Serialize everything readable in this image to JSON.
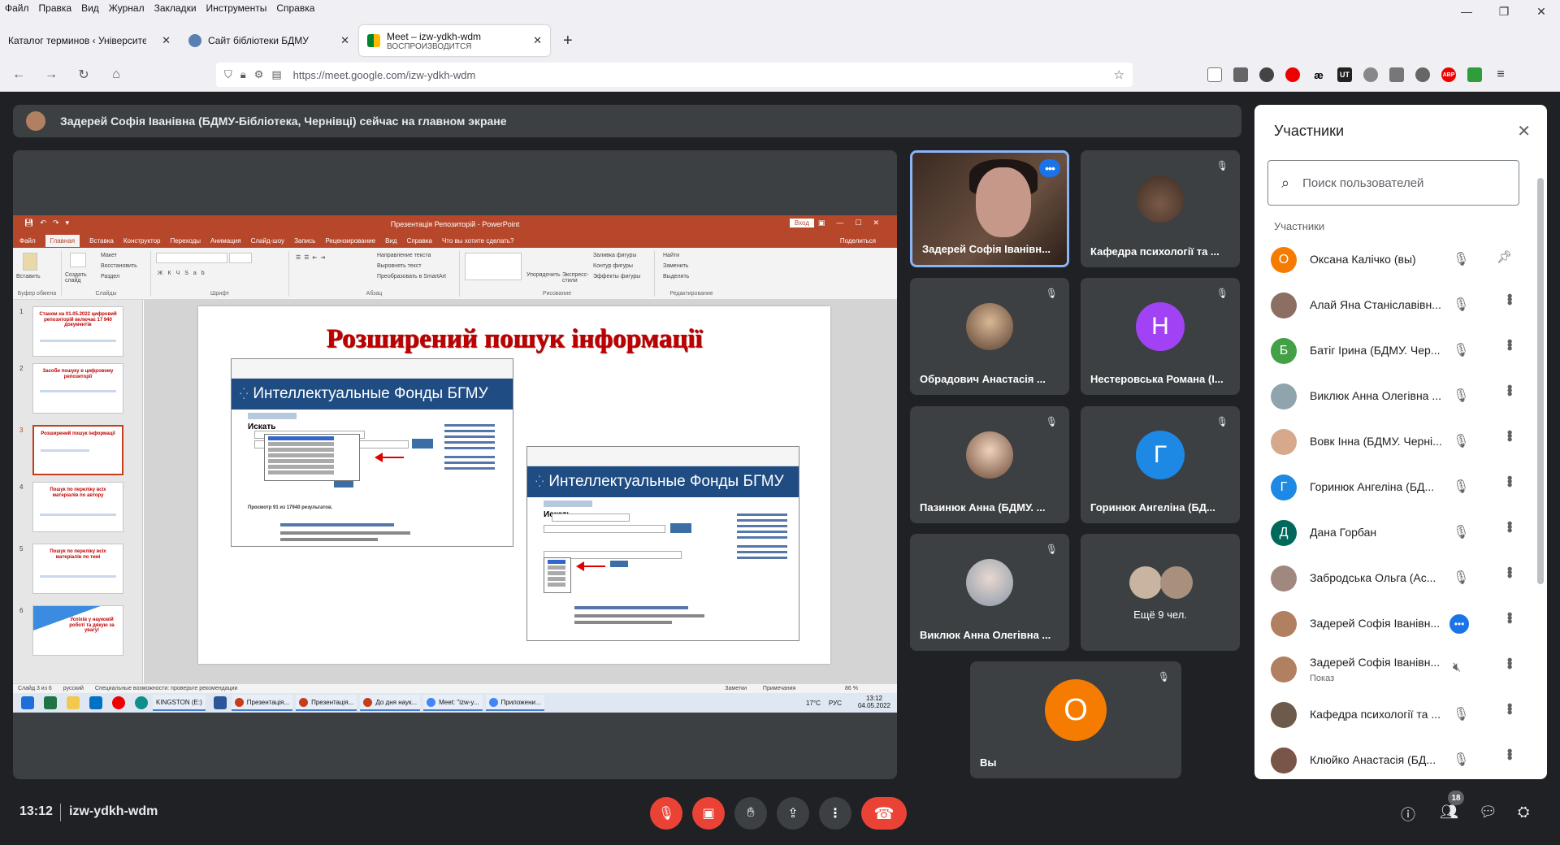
{
  "browser": {
    "menu": [
      "Файл",
      "Правка",
      "Вид",
      "Журнал",
      "Закладки",
      "Инструменты",
      "Справка"
    ],
    "tabs": [
      {
        "title": "Каталог терминов ‹ Університетоз",
        "sub": ""
      },
      {
        "title": "Сайт бібліотеки БДМУ",
        "sub": ""
      },
      {
        "title": "Meet – izw-ydkh-wdm",
        "sub": "ВОСПРОИЗВОДИТСЯ"
      }
    ],
    "url": "https://meet.google.com/izw-ydkh-wdm",
    "ext": {
      "abp": "ABP",
      "ae": "æ",
      "ut": "UT"
    }
  },
  "banner": "Задерей Софія Іванівна (БДМУ-Бібліотека, Чернівці) сейчас на главном экране",
  "presentation": {
    "window_title": "Презентація Репозиторій - PowerPoint",
    "login": "Вход",
    "ribbon_tabs": [
      "Файл",
      "Главная",
      "Вставка",
      "Конструктор",
      "Переходы",
      "Анимация",
      "Слайд-шоу",
      "Запись",
      "Рецензирование",
      "Вид",
      "Справка",
      "Что вы хотите сделать?"
    ],
    "share": "Поделиться",
    "ribbon": {
      "paste": "Вставить",
      "new_slide": "Создать слайд",
      "layout": "Макет",
      "reset": "Восстановить",
      "section": "Раздел",
      "g_clip": "Буфер обмена",
      "g_slides": "Слайды",
      "g_font": "Шрифт",
      "g_para": "Абзац",
      "g_draw": "Рисование",
      "g_edit": "Редактирование",
      "text_dir": "Направление текста",
      "align_text": "Выровнять текст",
      "smartart": "Преобразовать в SmartArt",
      "arrange": "Упорядочить",
      "quick": "Экспресс-стили",
      "fill": "Заливка фигуры",
      "outline": "Контур фигуры",
      "effects": "Эффекты фигуры",
      "find": "Найти",
      "replace": "Заменить",
      "select": "Выделить"
    },
    "thumbs": [
      {
        "n": "1",
        "t": "Станом на 01.05.2022 цифровий репозиторій включає 17 940 документів"
      },
      {
        "n": "2",
        "t": "Засоби пошуку в цифровому репозиторії"
      },
      {
        "n": "3",
        "t": "Розширений пошук інформації"
      },
      {
        "n": "4",
        "t": "Пошук по переліку всіх матеріалів по автору"
      },
      {
        "n": "5",
        "t": "Пошук по переліку всіх матеріалів по темі"
      },
      {
        "n": "6",
        "t": "Успіхів у науковій роботі та дякую за увагу!"
      }
    ],
    "slide_title": "Розширений пошук інформації",
    "site_title": "Интеллектуальные Фонды БГМУ",
    "search_label": "Искать",
    "results": "Просмотр 91 из 17940 результатов.",
    "status": {
      "slide": "Слайд 3 из 6",
      "lang": "русский",
      "access": "Специальные возможности: проверьте рекомендации",
      "notes": "Заметки",
      "comments": "Примечания",
      "zoom": "86 %"
    },
    "taskbar": {
      "drive": "KINGSTON (E:)",
      "w1": "Презентація...",
      "w2": "Презентація...",
      "w3": "До дня наук...",
      "w4": "Meet: \"izw-y...",
      "w5": "Приложени...",
      "temp": "17°C",
      "lang": "РУС",
      "time": "13:12",
      "date": "04.05.2022"
    }
  },
  "tiles": [
    {
      "name": "Задерей Софія Іванівн...",
      "type": "video"
    },
    {
      "name": "Кафедра психології та ...",
      "type": "photo"
    },
    {
      "name": "Обрадович Анастасія ...",
      "type": "photo"
    },
    {
      "name": "Нестеровська Романа (І...",
      "type": "letter",
      "letter": "Н",
      "color": "#a142f4"
    },
    {
      "name": "Пазинюк Анна (БДМУ. ...",
      "type": "photo"
    },
    {
      "name": "Горинюк Ангеліна (БД...",
      "type": "letter",
      "letter": "Г",
      "color": "#1e88e5"
    },
    {
      "name": "Виклюк Анна Олегівна ...",
      "type": "photo"
    },
    {
      "name": "Ещё 9 чел.",
      "type": "more"
    },
    {
      "name": "Вы",
      "type": "letter",
      "letter": "О",
      "color": "#f57c00"
    }
  ],
  "panel": {
    "title": "Участники",
    "search_placeholder": "Поиск пользователей",
    "section": "Участники",
    "people": [
      {
        "name": "Оксана Калічко (вы)",
        "letter": "О",
        "color": "#f57c00"
      },
      {
        "name": "Алай Яна Станіславівн...",
        "letter": "",
        "color": "#8d6e63"
      },
      {
        "name": "Батіг Ірина (БДМУ. Чер...",
        "letter": "Б",
        "color": "#43a047"
      },
      {
        "name": "Виклюк Анна Олегівна ...",
        "letter": "",
        "color": "#90a4ae"
      },
      {
        "name": "Вовк Інна (БДМУ. Черні...",
        "letter": "",
        "color": "#d7a98c"
      },
      {
        "name": "Горинюк Ангеліна (БД...",
        "letter": "Г",
        "color": "#1e88e5"
      },
      {
        "name": "Дана Горбан",
        "letter": "Д",
        "color": "#00695c"
      },
      {
        "name": "Забродська Ольга (Ас...",
        "letter": "",
        "color": "#a1887f"
      },
      {
        "name": "Задерей Софія Іванівн...",
        "letter": "",
        "color": "#b08060"
      },
      {
        "name": "Задерей Софія Іванівн...",
        "letter": "",
        "color": "#b08060",
        "sub": "Показ"
      },
      {
        "name": "Кафедра психології та ...",
        "letter": "",
        "color": "#6d5a4a"
      },
      {
        "name": "Клюйко Анастасія (БД...",
        "letter": "",
        "color": "#795548"
      }
    ]
  },
  "controls": {
    "time": "13:12",
    "code": "izw-ydkh-wdm",
    "count": "18"
  },
  "colors": {
    "meet_bg": "#202124",
    "tile_bg": "#3c4043",
    "red": "#ea4335",
    "blue": "#1a73e8",
    "ppt": "#b7472a"
  }
}
